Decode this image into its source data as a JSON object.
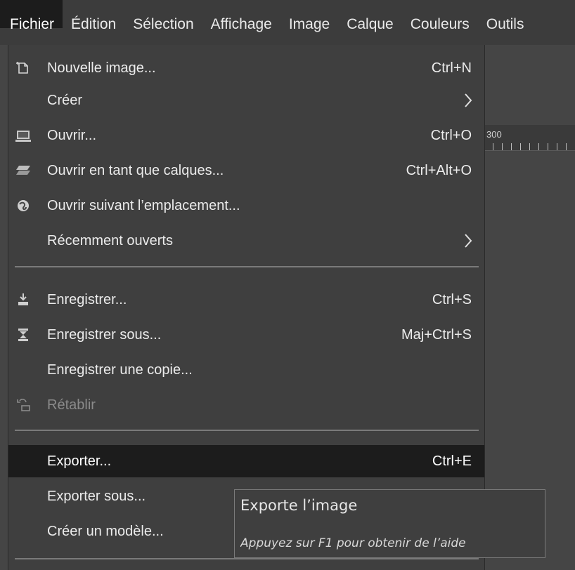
{
  "menubar": {
    "items": [
      {
        "label": "Fichier"
      },
      {
        "label": "Édition"
      },
      {
        "label": "Sélection"
      },
      {
        "label": "Affichage"
      },
      {
        "label": "Image"
      },
      {
        "label": "Calque"
      },
      {
        "label": "Couleurs"
      },
      {
        "label": "Outils"
      }
    ]
  },
  "ruler": {
    "label": "300"
  },
  "file_menu": {
    "items": [
      {
        "label": "Nouvelle image...",
        "shortcut": "Ctrl+N",
        "icon": "new-image-icon"
      },
      {
        "label": "Créer",
        "submenu": true
      },
      {
        "label": "Ouvrir...",
        "shortcut": "Ctrl+O",
        "icon": "open-icon"
      },
      {
        "label": "Ouvrir en tant que calques...",
        "shortcut": "Ctrl+Alt+O",
        "icon": "open-as-layers-icon"
      },
      {
        "label": "Ouvrir suivant l’emplacement...",
        "icon": "open-location-icon"
      },
      {
        "label": "Récemment ouverts",
        "submenu": true
      },
      {
        "label": "Enregistrer...",
        "shortcut": "Ctrl+S",
        "icon": "save-icon"
      },
      {
        "label": "Enregistrer sous...",
        "shortcut": "Maj+Ctrl+S",
        "icon": "save-as-icon"
      },
      {
        "label": "Enregistrer une copie..."
      },
      {
        "label": "Rétablir",
        "disabled": true,
        "icon": "revert-icon"
      },
      {
        "label": "Exporter...",
        "shortcut": "Ctrl+E",
        "highlighted": true
      },
      {
        "label": "Exporter sous..."
      },
      {
        "label": "Créer un modèle..."
      }
    ]
  },
  "tooltip": {
    "title": "Exporte l’image",
    "help": "Appuyez sur F1 pour obtenir de l’aide"
  },
  "colors": {
    "menu_bg": "#3f3f3f",
    "highlight_bg": "#1c1c1c",
    "text": "#ebebeb",
    "disabled_text": "#8a8a8a"
  }
}
